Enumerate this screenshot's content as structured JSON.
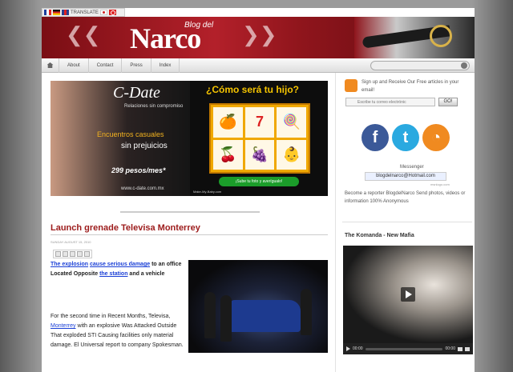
{
  "translate": {
    "label": "TRANSLATE"
  },
  "header": {
    "logo_top": "Blog del",
    "logo_main": "Narco"
  },
  "nav": {
    "items": [
      {
        "label": "About"
      },
      {
        "label": "Contact"
      },
      {
        "label": "Press"
      },
      {
        "label": "Index"
      }
    ]
  },
  "ad": {
    "brand": "C-Date",
    "tagline": "Relaciones sin compromiso",
    "line1": "Encuentros casuales",
    "line2": "sin prejuicios",
    "price": "299 pesos/mes*",
    "url": "www.c-date.com.mx",
    "slot_title": "¿Cómo será tu hijo?",
    "slot_button": "¡Sube tu foto y averígualo!",
    "slot_url": "Make-My-Baby.com"
  },
  "post": {
    "title": "Launch grenade Televisa Monterrey",
    "date": "SUNDAY AUGUST 15, 2010",
    "lead": {
      "link1": "The explosion",
      "link2": "cause serious damage",
      "text1": "to an office Located Opposite",
      "link3": "the station",
      "text2": "and a vehicle"
    },
    "body": {
      "text1": "For the second time in Recent Months, Televisa,",
      "link": "Monterrey",
      "text2": "with an explosive Was Attacked Outside That exploded STI Causing facilities only material damage. El Universal report to company Spokesman."
    }
  },
  "sidebar": {
    "subscribe": "Sign up and Receive Our Free articles in your email!",
    "email_placeholder": "Escribe tu correo electrónic",
    "go": "GO!",
    "messenger_label": "Messenger",
    "msn_address": "blogdelnarco@Hotmail.com",
    "msn_small": "msnlogo.com",
    "reporter": "Become a reporter BlogdelNarco Send photos, videos or information 100% Anonymous",
    "heading": "The Komanda - New Mafia",
    "video": {
      "time_current": "00:00",
      "time_total": "00:00"
    }
  },
  "colors": {
    "accent": "#9c1b1b",
    "header": "#b3202a",
    "link": "#1a3fd6"
  }
}
